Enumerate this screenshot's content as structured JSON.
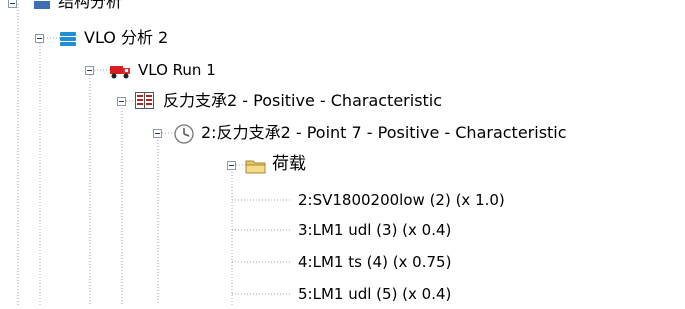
{
  "colors": {
    "tree_line": "#9aa6b2",
    "expander_border": "#8a9aaa",
    "stack_icon": "#1e8fd6",
    "truck_icon": "#d41f1f",
    "report_icon": "#b32222",
    "folder_icon": "#e8c860"
  },
  "tree": {
    "root": {
      "label": "结构分析",
      "icon": "root-icon"
    },
    "analysis": {
      "label": "VLO 分析 2",
      "icon": "stack-icon"
    },
    "run": {
      "label": "VLO Run 1",
      "icon": "truck-icon"
    },
    "result": {
      "label": "反力支承2 - Positive - Characteristic",
      "icon": "report-icon"
    },
    "point": {
      "label": "2:反力支承2 - Point 7 - Positive - Characteristic",
      "icon": "clock-icon"
    },
    "loads": {
      "label": "荷载",
      "icon": "folder-icon"
    },
    "load_items": [
      {
        "label": "2:SV1800200low (2) (x 1.0)"
      },
      {
        "label": "3:LM1 udl (3) (x 0.4)"
      },
      {
        "label": "4:LM1 ts (4) (x 0.75)"
      },
      {
        "label": "5:LM1 udl (5) (x 0.4)"
      }
    ]
  }
}
